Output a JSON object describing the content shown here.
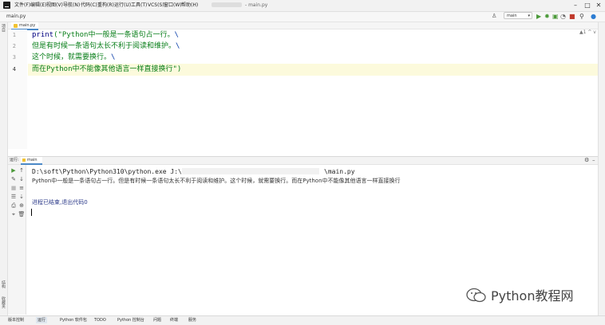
{
  "titlebar": {
    "menus": [
      "文件(F)",
      "编辑(E)",
      "视图(V)",
      "导航(N)",
      "代码(C)",
      "重构(R)",
      "运行(U)",
      "工具(T)",
      "VCS(S)",
      "窗口(W)",
      "帮助(H)"
    ],
    "window_title": "- main.py"
  },
  "toolbar": {
    "breadcrumb": "main.py",
    "run_config": "main"
  },
  "editor": {
    "tab_label": "main.py",
    "inspection": "▲1 ^ v",
    "line_numbers": [
      "1",
      "2",
      "3",
      "4"
    ],
    "lines": [
      {
        "fn": "print",
        "text": "(\"Python中一般是一条语句占一行。",
        "esc": "\\"
      },
      {
        "fn": "",
        "text": "但是有时候一条语句太长不利于阅读和维护。",
        "esc": "\\"
      },
      {
        "fn": "",
        "text": "这个时候，就需要换行。",
        "esc": "\\"
      },
      {
        "fn": "",
        "text": "而在Python中不能像其他语言一样直接换行\")",
        "esc": ""
      }
    ]
  },
  "run_panel": {
    "label": "运行:",
    "tab_label": "main",
    "command_prefix": "D:\\soft\\Python\\Python310\\python.exe J:\\",
    "command_suffix": "\\main.py",
    "output": "Python中一般是一条语句占一行。但是有时候一条语句太长不利于阅读和维护。这个时候，就需要换行。而在Python中不能像其他语言一样直接换行",
    "exit_message": "进程已结束,退出代码0"
  },
  "left_strip": {
    "top_tab": "项目",
    "bottom_tabs": [
      "结构",
      "收藏夹"
    ]
  },
  "statusbar": {
    "items": [
      "版本控制",
      "运行",
      "Python 软件包",
      "TODO",
      "Python 控制台",
      "问题",
      "终端",
      "服务"
    ]
  },
  "watermark": {
    "text": "Python教程网"
  }
}
